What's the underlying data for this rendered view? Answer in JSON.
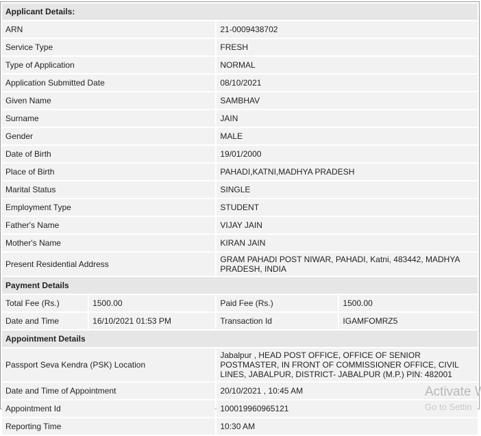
{
  "applicant": {
    "heading": "Applicant Details:",
    "rows": [
      {
        "label": "ARN",
        "value": "21-0009438702"
      },
      {
        "label": "Service Type",
        "value": "FRESH"
      },
      {
        "label": "Type of Application",
        "value": "NORMAL"
      },
      {
        "label": "Application Submitted Date",
        "value": "08/10/2021"
      },
      {
        "label": "Given Name",
        "value": "SAMBHAV"
      },
      {
        "label": "Surname",
        "value": "JAIN"
      },
      {
        "label": "Gender",
        "value": "MALE"
      },
      {
        "label": "Date of Birth",
        "value": "19/01/2000"
      },
      {
        "label": "Place of Birth",
        "value": "PAHADI,KATNI,MADHYA PRADESH"
      },
      {
        "label": "Marital Status",
        "value": "SINGLE"
      },
      {
        "label": "Employment Type",
        "value": "STUDENT"
      },
      {
        "label": "Father's Name",
        "value": "VIJAY JAIN"
      },
      {
        "label": "Mother's Name",
        "value": "KIRAN JAIN"
      },
      {
        "label": "Present Residential Address",
        "value": "GRAM PAHADI POST NIWAR, PAHADI, Katni, 483442, MADHYA PRADESH, INDIA"
      }
    ]
  },
  "payment": {
    "heading": "Payment Details",
    "total_fee_label": "Total Fee (Rs.)",
    "total_fee_value": "1500.00",
    "paid_fee_label": "Paid Fee (Rs.)",
    "paid_fee_value": "1500.00",
    "date_time_label": "Date and Time",
    "date_time_value": "16/10/2021 01:53 PM",
    "transaction_label": "Transaction Id",
    "transaction_value": "IGAMFOMRZ5"
  },
  "appointment": {
    "heading": "Appointment Details",
    "rows": [
      {
        "label": "Passport Seva Kendra (PSK) Location",
        "value": "Jabalpur , HEAD POST OFFICE, OFFICE OF SENIOR POSTMASTER, IN FRONT OF COMMISSIONER OFFICE, CIVIL LINES, JABALPUR, DISTRICT- JABALPUR (M.P.) PIN: 482001"
      },
      {
        "label": "Date and Time of Appointment",
        "value": "20/10/2021 , 10:45 AM"
      },
      {
        "label": "Appointment Id",
        "value": "100019960965121"
      },
      {
        "label": "Reporting Time",
        "value": "10:30 AM"
      }
    ]
  },
  "watermark": {
    "line1": "Activate W",
    "line2": "Go to Settin"
  }
}
